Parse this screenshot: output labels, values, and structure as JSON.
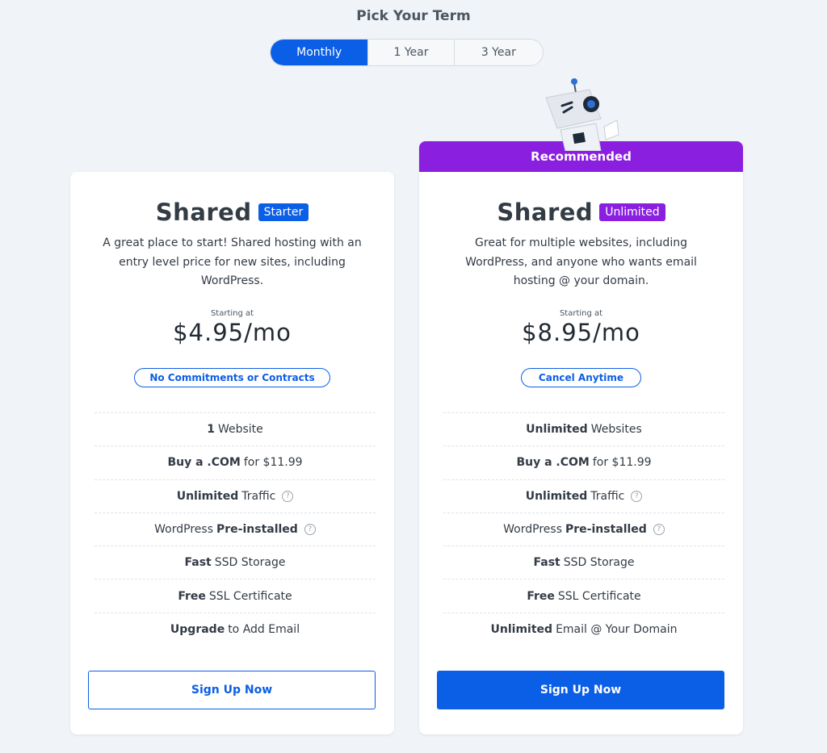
{
  "heading": "Pick Your Term",
  "term_options": [
    "Monthly",
    "1 Year",
    "3 Year"
  ],
  "selected_term": "Monthly",
  "colors": {
    "accent_blue": "#0b5ee6",
    "accent_purple": "#8a1fe0",
    "background": "#f0f3f7"
  },
  "plans": [
    {
      "name": "Shared",
      "tag": "Starter",
      "description": "A great place to start! Shared hosting with an entry level price for new sites, including WordPress.",
      "starting_label": "Starting at",
      "price": "$4.95/mo",
      "pill": "No Commitments or Contracts",
      "features": [
        {
          "bold": "1",
          "text": "Website"
        },
        {
          "bold": "Buy a .COM",
          "text": "for $11.99"
        },
        {
          "bold": "Unlimited",
          "text": "Traffic"
        },
        {
          "pre": "WordPress",
          "bold": "Pre-installed"
        },
        {
          "bold": "Fast",
          "text": "SSD Storage"
        },
        {
          "bold": "Free",
          "text": "SSL Certificate"
        },
        {
          "bold": "Upgrade",
          "text": "to Add Email"
        }
      ],
      "cta": "Sign Up Now"
    },
    {
      "name": "Shared",
      "tag": "Unlimited",
      "banner": "Recommended",
      "description": "Great for multiple websites, including WordPress, and anyone who wants email hosting @ your domain.",
      "starting_label": "Starting at",
      "price": "$8.95/mo",
      "pill": "Cancel Anytime",
      "features": [
        {
          "bold": "Unlimited",
          "text": "Websites"
        },
        {
          "bold": "Buy a .COM",
          "text": "for $11.99"
        },
        {
          "bold": "Unlimited",
          "text": "Traffic"
        },
        {
          "pre": "WordPress",
          "bold": "Pre-installed"
        },
        {
          "bold": "Fast",
          "text": "SSD Storage"
        },
        {
          "bold": "Free",
          "text": "SSL Certificate"
        },
        {
          "bold": "Unlimited",
          "text": "Email @ Your Domain"
        }
      ],
      "cta": "Sign Up Now"
    }
  ]
}
